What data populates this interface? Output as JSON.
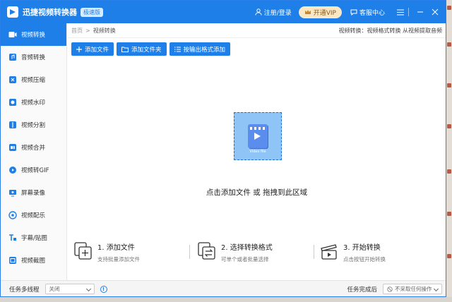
{
  "app": {
    "title": "迅捷视频转换器",
    "edition": "极速版",
    "login": "注册/登录",
    "vip": "开通VIP",
    "service": "客服中心"
  },
  "sidebar": {
    "items": [
      {
        "label": "视频转换",
        "icon": "video-convert-icon",
        "active": true
      },
      {
        "label": "音频转换",
        "icon": "audio-convert-icon"
      },
      {
        "label": "视频压缩",
        "icon": "compress-icon"
      },
      {
        "label": "视频水印",
        "icon": "watermark-icon"
      },
      {
        "label": "视频分割",
        "icon": "split-icon"
      },
      {
        "label": "视频合并",
        "icon": "merge-icon"
      },
      {
        "label": "视频转GIF",
        "icon": "gif-icon"
      },
      {
        "label": "屏幕录像",
        "icon": "screen-record-icon"
      },
      {
        "label": "视频配乐",
        "icon": "music-icon"
      },
      {
        "label": "字幕/贴图",
        "icon": "subtitle-icon"
      },
      {
        "label": "视频截图",
        "icon": "screenshot-icon"
      }
    ]
  },
  "breadcrumb": {
    "home": "首页",
    "separator": ">",
    "current": "视频转换",
    "hint": "视频转换：视频格式转换 从视频提取音频"
  },
  "toolbar": {
    "add_file": "添加文件",
    "add_folder": "添加文件夹",
    "add_by_format": "按输出格式添加"
  },
  "drop": {
    "file_label": "Video file",
    "hint": "点击添加文件 或 拖拽到此区域"
  },
  "steps": [
    {
      "title": "1. 添加文件",
      "desc": "支持批量添加文件"
    },
    {
      "title": "2. 选择转换格式",
      "desc": "可单个或者批量选择"
    },
    {
      "title": "3. 开始转换",
      "desc": "点击按钮开始转换"
    }
  ],
  "status": {
    "multithread_label": "任务多线程",
    "multithread_value": "关闭",
    "after_complete_label": "任务完成后",
    "after_complete_value": "不采取任何操作"
  },
  "colors": {
    "accent": "#1f7fe8",
    "vip_bg": "#fbe7c4",
    "drop_bg": "#8ec5f6"
  }
}
